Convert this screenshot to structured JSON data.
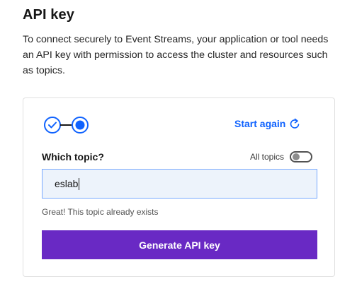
{
  "header": {
    "title": "API key",
    "description": "To connect securely to Event Streams, your application or tool needs an API key with permission to access the cluster and resources such as topics."
  },
  "card": {
    "stepper": {
      "steps_completed": 1,
      "current_step": 2,
      "total_steps": 2,
      "complete_icon": "checkmark-icon",
      "current_icon": "current-step-dot-icon"
    },
    "start_again": {
      "label": "Start again",
      "icon": "restart-icon"
    },
    "topic_field": {
      "label": "Which topic?",
      "value": "eslab",
      "helper": "Great! This topic already exists"
    },
    "all_topics_toggle": {
      "label": "All topics",
      "on": false
    },
    "generate_button": {
      "label": "Generate API key"
    }
  },
  "colors": {
    "accent_blue": "#0f62fe",
    "button_purple": "#6929c4",
    "input_background": "#edf3fb",
    "input_border": "#78a9ff"
  }
}
